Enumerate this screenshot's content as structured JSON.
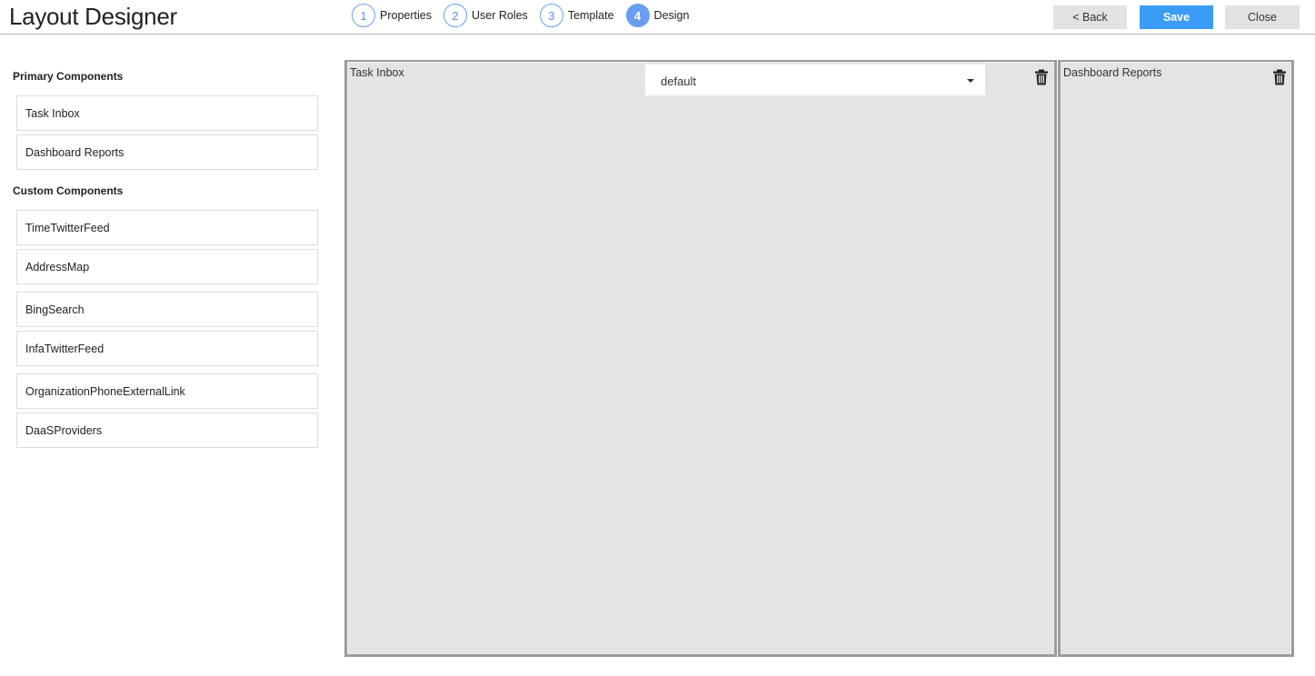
{
  "header": {
    "title": "Layout Designer",
    "steps": [
      {
        "number": "1",
        "label": "Properties",
        "active": false
      },
      {
        "number": "2",
        "label": "User Roles",
        "active": false
      },
      {
        "number": "3",
        "label": "Template",
        "active": false
      },
      {
        "number": "4",
        "label": "Design",
        "active": true
      }
    ],
    "buttons": {
      "back": "< Back",
      "save": "Save",
      "close": "Close"
    },
    "colors": {
      "accent": "#3b9cf5",
      "step_active": "#6a9ef2"
    }
  },
  "palette": {
    "primary_title": "Primary Components",
    "primary": [
      "Task Inbox",
      "Dashboard Reports"
    ],
    "custom_title": "Custom Components",
    "custom": [
      "TimeTwitterFeed",
      "AddressMap",
      "BingSearch",
      "InfaTwitterFeed",
      "OrganizationPhoneExternalLink",
      "DaaSProviders"
    ]
  },
  "canvas": {
    "main_panel": {
      "title": "Task Inbox",
      "select_value": "default",
      "delete_icon": "trash-icon"
    },
    "side_panel": {
      "title": "Dashboard Reports",
      "delete_icon": "trash-icon"
    }
  }
}
